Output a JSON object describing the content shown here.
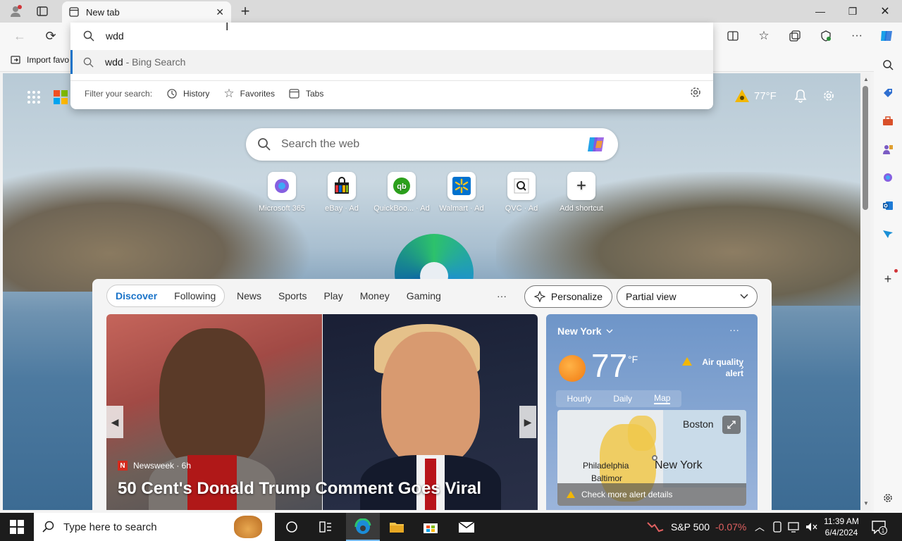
{
  "browser": {
    "tab_title": "New tab",
    "fav_bar_label": "Import favo",
    "address_input": "wdd"
  },
  "suggestions": {
    "items": [
      {
        "query": "wdd",
        "suffix": " - Bing Search"
      }
    ],
    "filter_label": "Filter your search:",
    "filters": [
      "History",
      "Favorites",
      "Tabs"
    ]
  },
  "newtab": {
    "search_placeholder": "Search the web",
    "temperature": "77°F",
    "quick_links": [
      {
        "label": "Microsoft 365"
      },
      {
        "label": "eBay · Ad"
      },
      {
        "label": "QuickBoo... · Ad"
      },
      {
        "label": "Walmart · Ad"
      },
      {
        "label": "QVC · Ad"
      },
      {
        "label": "Add shortcut"
      }
    ]
  },
  "feed": {
    "tabs": [
      "Discover",
      "Following"
    ],
    "nav": [
      "News",
      "Sports",
      "Play",
      "Money",
      "Gaming"
    ],
    "more": "···",
    "personalize": "Personalize",
    "view_select": "Partial view",
    "hero": {
      "source": "Newsweek · 6h",
      "headline": "50 Cent's Donald Trump Comment Goes Viral"
    }
  },
  "weather": {
    "location": "New York",
    "temp": "77",
    "unit": "°F",
    "alert": "Air quality alert",
    "tabs": [
      "Hourly",
      "Daily",
      "Map"
    ],
    "map_labels": [
      "Boston",
      "Philadelphia",
      "New York",
      "Baltimor"
    ],
    "alert_details": "Check more alert details"
  },
  "taskbar": {
    "search_placeholder": "Type here to search",
    "stock_name": "S&P 500",
    "stock_change": "-0.07%",
    "time": "11:39 AM",
    "date": "6/4/2024",
    "notif_count": "1"
  },
  "colors": {
    "accent": "#1a73c8",
    "stock_down": "#e06060",
    "edge_blue": "#0a5fa8"
  }
}
